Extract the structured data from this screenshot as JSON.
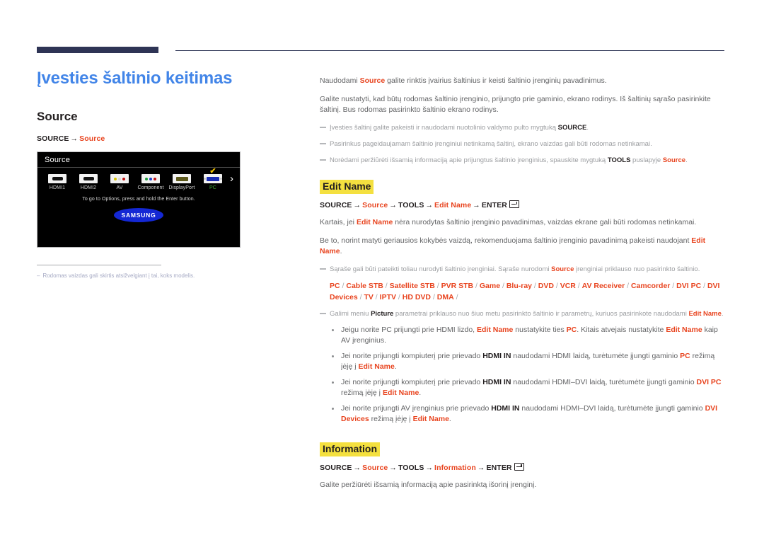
{
  "document": {
    "title": "Įvesties šaltinio keitimas",
    "accent_blue": "#4285e8",
    "accent_red": "#e8441f",
    "highlight_yellow": "#f4e03f",
    "rule_navy": "#2e3455"
  },
  "left": {
    "section_heading": "Source",
    "breadcrumb": {
      "root": "SOURCE",
      "arrow": "→",
      "leaf": "Source"
    },
    "tv_screenshot": {
      "title": "Source",
      "sources": [
        {
          "label": "HDMI1",
          "icon": "hdmi-port-icon",
          "selected": false
        },
        {
          "label": "HDMI2",
          "icon": "hdmi-port-icon",
          "selected": false
        },
        {
          "label": "AV",
          "icon": "rca-av-port-icon",
          "selected": false
        },
        {
          "label": "Component",
          "icon": "rca-component-port-icon",
          "selected": false
        },
        {
          "label": "DisplayPort",
          "icon": "displayport-port-icon",
          "selected": false
        },
        {
          "label": "PC",
          "icon": "vga-port-icon",
          "selected": true
        }
      ],
      "next_arrow": "›",
      "checkmark": "✔",
      "hint": "To go to Options, press and hold the Enter button.",
      "brand": "SAMSUNG"
    },
    "footnote": {
      "dash": "–",
      "text": "Rodomas vaizdas gali skirtis atsižvelgiant į tai, koks modelis."
    }
  },
  "right": {
    "intro": {
      "p1_a": "Naudodami ",
      "p1_b": "Source",
      "p1_c": " galite rinktis įvairius šaltinius ir keisti šaltinio įrenginių pavadinimus.",
      "p2": "Galite nustatyti, kad būtų rodomas šaltinio įrenginio, prijungto prie gaminio, ekrano rodinys. Iš šaltinių sąrašo pasirinkite šaltinį. Bus rodomas pasirinkto šaltinio ekrano rodinys."
    },
    "intro_notes": [
      {
        "a": "Įvesties šaltinį galite pakeisti ir naudodami nuotolinio valdymo pulto mygtuką ",
        "b": "SOURCE",
        "b_style": "black",
        "c": "."
      },
      {
        "a": "Pasirinkus pageidaujamam šaltinio įrenginiui netinkamą šaltinį, ekrano vaizdas gali būti rodomas netinkamai.",
        "b": "",
        "b_style": "black",
        "c": ""
      },
      {
        "a": "Norėdami peržiūrėti išsamią informaciją apie prijungtus šaltinio įrenginius, spauskite mygtuką ",
        "b": "TOOLS",
        "b_style": "black",
        "c": " puslapyje ",
        "d": "Source",
        "d_style": "red",
        "e": "."
      }
    ],
    "edit_name": {
      "heading": "Edit Name",
      "path": {
        "s1": "SOURCE",
        "s2": "Source",
        "s3": "TOOLS",
        "s4": "Edit Name",
        "s5": "ENTER",
        "arrow": "→",
        "enter_icon": "enter-key-icon"
      },
      "p1_a": "Kartais, jei ",
      "p1_b": "Edit Name",
      "p1_c": " nėra nurodytas šaltinio įrenginio pavadinimas, vaizdas ekrane gali būti rodomas netinkamai.",
      "p2_a": "Be to, norint matyti geriausios kokybės vaizdą, rekomenduojama šaltinio įrenginio pavadinimą pakeisti naudojant ",
      "p2_b": "Edit Name",
      "p2_c": ".",
      "note1_a": "Sąraše gali būti pateikti toliau nurodyti šaltinio įrenginiai. Sąraše nurodomi ",
      "note1_b": "Source",
      "note1_c": " įrenginiai priklauso nuo pasirinkto šaltinio.",
      "device_list": [
        "PC",
        "Cable STB",
        "Satellite STB",
        "PVR STB",
        "Game",
        "Blu-ray",
        "DVD",
        "VCR",
        "AV Receiver",
        "Camcorder",
        "DVI PC",
        "DVI Devices",
        "TV",
        "IPTV",
        "HD DVD",
        "DMA"
      ],
      "device_separator": "/",
      "note2_a": "Galimi meniu ",
      "note2_b": "Picture",
      "note2_c": " parametrai priklauso nuo šiuo metu pasirinkto šaltinio ir parametrų, kuriuos pasirinkote naudodami ",
      "note2_d": "Edit Name",
      "note2_e": ".",
      "bullets": [
        {
          "parts": [
            {
              "t": "Jeigu norite PC prijungti prie HDMI lizdo, ",
              "s": "plain"
            },
            {
              "t": "Edit Name",
              "s": "red"
            },
            {
              "t": " nustatykite ties ",
              "s": "plain"
            },
            {
              "t": "PC",
              "s": "red"
            },
            {
              "t": ". Kitais atvejais nustatykite ",
              "s": "plain"
            },
            {
              "t": "Edit Name",
              "s": "red"
            },
            {
              "t": " kaip AV įrenginius.",
              "s": "plain"
            }
          ]
        },
        {
          "parts": [
            {
              "t": "Jei norite prijungti kompiuterį prie prievado ",
              "s": "plain"
            },
            {
              "t": "HDMI IN",
              "s": "black"
            },
            {
              "t": " naudodami HDMI laidą, turėtumėte įjungti gaminio ",
              "s": "plain"
            },
            {
              "t": "PC",
              "s": "red"
            },
            {
              "t": " režimą įėję į ",
              "s": "plain"
            },
            {
              "t": "Edit Name",
              "s": "red"
            },
            {
              "t": ".",
              "s": "plain"
            }
          ]
        },
        {
          "parts": [
            {
              "t": "Jei norite prijungti kompiuterį prie prievado ",
              "s": "plain"
            },
            {
              "t": "HDMI IN",
              "s": "black"
            },
            {
              "t": "  naudodami HDMI–DVI laidą, turėtumėte įjungti gaminio ",
              "s": "plain"
            },
            {
              "t": "DVI PC",
              "s": "red"
            },
            {
              "t": " režimą įėję į ",
              "s": "plain"
            },
            {
              "t": "Edit Name",
              "s": "red"
            },
            {
              "t": ".",
              "s": "plain"
            }
          ]
        },
        {
          "parts": [
            {
              "t": "Jei norite prijungti AV įrenginius prie prievado ",
              "s": "plain"
            },
            {
              "t": "HDMI IN",
              "s": "black"
            },
            {
              "t": " naudodami HDMI–DVI laidą, turėtumėte įjungti gaminio ",
              "s": "plain"
            },
            {
              "t": "DVI Devices",
              "s": "red"
            },
            {
              "t": " režimą įėję į ",
              "s": "plain"
            },
            {
              "t": "Edit Name",
              "s": "red"
            },
            {
              "t": ".",
              "s": "plain"
            }
          ]
        }
      ]
    },
    "information": {
      "heading": "Information",
      "path": {
        "s1": "SOURCE",
        "s2": "Source",
        "s3": "TOOLS",
        "s4": "Information",
        "s5": "ENTER",
        "arrow": "→",
        "enter_icon": "enter-key-icon"
      },
      "p1": "Galite peržiūrėti išsamią informaciją apie pasirinktą išorinį įrenginį."
    }
  }
}
